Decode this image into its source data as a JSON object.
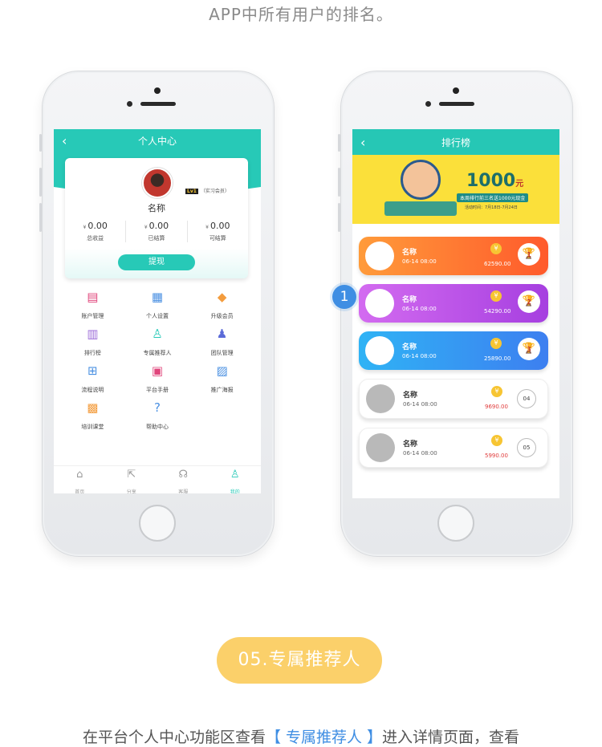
{
  "top_caption": "APP中所有用户的排名。",
  "left_phone": {
    "header": {
      "back": "‹",
      "title": "个人中心"
    },
    "profile": {
      "badge_level": "Lv1",
      "badge_text": "（实习会员）",
      "name": "名称",
      "currency": "¥",
      "stats": [
        {
          "value": "0.00",
          "label": "总收益"
        },
        {
          "value": "0.00",
          "label": "已结算"
        },
        {
          "value": "0.00",
          "label": "可结算"
        }
      ],
      "withdraw_label": "提现"
    },
    "menu": [
      {
        "label": "账户管理",
        "icon": "account-icon",
        "glyph": "▤",
        "color": "#e0457b"
      },
      {
        "label": "个人设置",
        "icon": "settings-doc-icon",
        "glyph": "▦",
        "color": "#4a90e2"
      },
      {
        "label": "升级会员",
        "icon": "diamond-icon",
        "glyph": "◆",
        "color": "#f39c3d"
      },
      {
        "label": "排行榜",
        "icon": "ranking-icon",
        "glyph": "▥",
        "color": "#9b6bd8"
      },
      {
        "label": "专属推荐人",
        "icon": "referrer-icon",
        "glyph": "♙",
        "color": "#27c9b7"
      },
      {
        "label": "团队管理",
        "icon": "team-icon",
        "glyph": "♟",
        "color": "#5b6bd8"
      },
      {
        "label": "流程说明",
        "icon": "flowchart-icon",
        "glyph": "⊞",
        "color": "#4a90e2"
      },
      {
        "label": "平台手册",
        "icon": "manual-icon",
        "glyph": "▣",
        "color": "#e0457b"
      },
      {
        "label": "推广海报",
        "icon": "poster-icon",
        "glyph": "▨",
        "color": "#4a90e2"
      },
      {
        "label": "培训课堂",
        "icon": "training-icon",
        "glyph": "▩",
        "color": "#f39c3d"
      },
      {
        "label": "帮助中心",
        "icon": "help-icon",
        "glyph": "?",
        "color": "#4a90e2"
      }
    ],
    "tabs": [
      {
        "label": "首页",
        "icon": "home-icon",
        "glyph": "⌂",
        "active": false
      },
      {
        "label": "分享",
        "icon": "share-icon",
        "glyph": "⇱",
        "active": false
      },
      {
        "label": "客服",
        "icon": "headset-icon",
        "glyph": "☊",
        "active": false
      },
      {
        "label": "我的",
        "icon": "user-icon",
        "glyph": "♙",
        "active": true
      }
    ]
  },
  "right_phone": {
    "header": {
      "back": "‹",
      "title": "排行榜"
    },
    "banner": {
      "amount": "1000",
      "amount_unit": "元",
      "line1": "本周排行前三名送1000元现金",
      "line2": "活动时间：7月18日-7月24日"
    },
    "ranks": [
      {
        "name": "名称",
        "time": "06-14 08:00",
        "score": "62590.00",
        "rank": "1",
        "style": "orange",
        "colors": [
          "#ff9b3a",
          "#ff5a2c"
        ]
      },
      {
        "name": "名称",
        "time": "06-14 08:00",
        "score": "54290.00",
        "rank": "2",
        "style": "purple",
        "colors": [
          "#d36bf0",
          "#a63fe0"
        ]
      },
      {
        "name": "名称",
        "time": "06-14 08:00",
        "score": "25890.00",
        "rank": "3",
        "style": "blue",
        "colors": [
          "#2fb3f5",
          "#3d7ff0"
        ]
      },
      {
        "name": "名称",
        "time": "06-14 08:00",
        "score": "9690.00",
        "rank": "04",
        "style": "plain",
        "colors": []
      },
      {
        "name": "名称",
        "time": "06-14 08:00",
        "score": "5990.00",
        "rank": "05",
        "style": "plain",
        "colors": []
      }
    ],
    "coin_glyph": "¥",
    "medal_glyph": "🏆"
  },
  "step_marker": "1",
  "section_pill": "05.专属推荐人",
  "bottom_caption": {
    "prefix": "在平台个人中心功能区查看",
    "highlight": "【 专属推荐人 】",
    "suffix": "进入详情页面，查看"
  }
}
